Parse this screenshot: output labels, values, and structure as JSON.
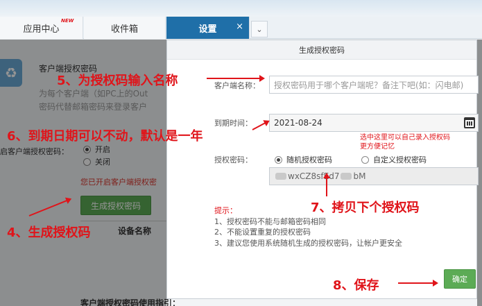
{
  "tabs": {
    "app_center": "应用中心",
    "new_badge": "NEW",
    "inbox": "收件箱",
    "settings": "设置",
    "close_glyph": "×",
    "more_glyph": "⌄"
  },
  "background": {
    "title": "客户端授权密码",
    "desc_line1": "为每个客户端（如PC上的Out",
    "desc_line2": "密码代替邮箱密码来登录客户",
    "toggle_label": "启客户端授权密码：",
    "option_on": "开启",
    "option_off": "关闭",
    "notice": "您已开启客户端授权密",
    "generate_button": "生成授权密码",
    "column_device": "设备名称",
    "bottom_heading": "客户端授权密码使用指引："
  },
  "dialog": {
    "title": "生成授权密码",
    "client_name_label": "客户端名称：",
    "client_name_placeholder": "授权密码用于哪个客户端呢？备注下吧(如：闪电邮)",
    "expiry_label": "到期时间：",
    "expiry_value": "2021-08-24",
    "password_label": "授权密码：",
    "random_option": "随机授权密码",
    "custom_option": "自定义授权密码",
    "password_visible_a": "wxCZ8sfEd7",
    "password_visible_b": "bM",
    "tips_title": "提示：",
    "tip1": "1、授权密码不能与邮箱密码相同",
    "tip2": "2、不能设置重复的授权密码",
    "tip3": "3、建议您使用系统随机生成的授权密码，让帐户更安全",
    "confirm_button": "确定"
  },
  "annotations": {
    "step4": "4、生成授权码",
    "step5": "5、为授权码输入名称",
    "step6": "6、到期日期可以不动，默认是一年",
    "step7": "7、拷贝下个授权码",
    "step8": "8、保存",
    "custom_hint_line1": "选中这里可以自己录入授权码",
    "custom_hint_line2": "更方便记忆"
  },
  "colors": {
    "accent_tab": "#1f6fa8",
    "button_green": "#5cab55",
    "annotation_red": "#e0141a"
  }
}
